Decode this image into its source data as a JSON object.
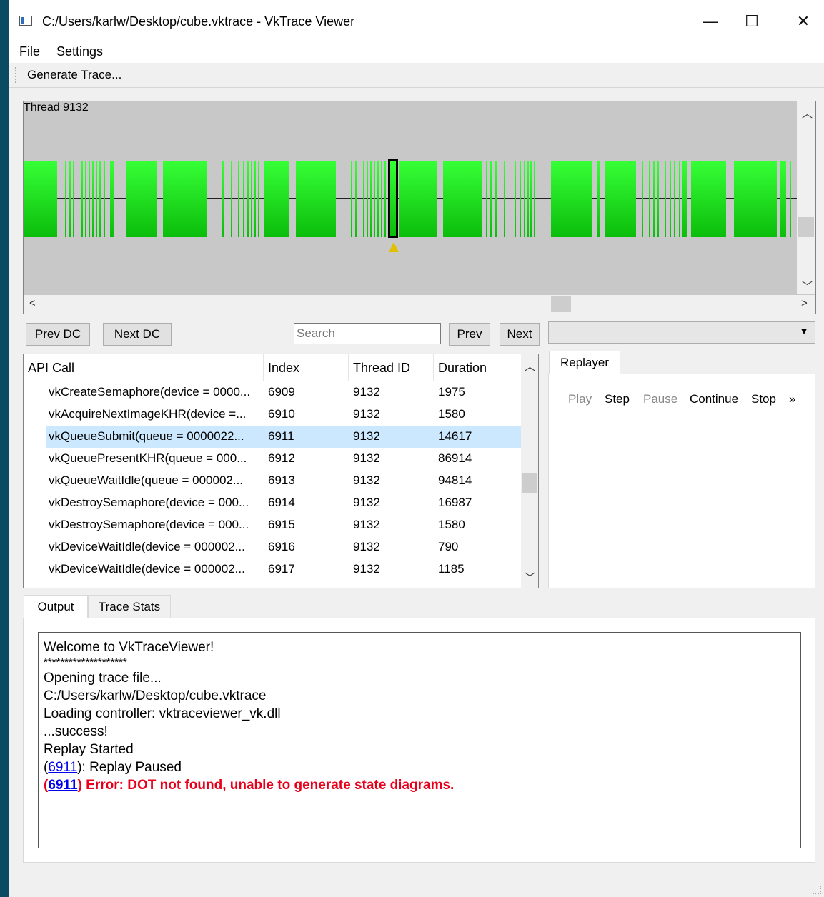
{
  "window": {
    "title": "C:/Users/karlw/Desktop/cube.vktrace - VkTrace Viewer",
    "minimize": "—",
    "maximize": "☐",
    "close": "✕"
  },
  "menu": {
    "file": "File",
    "settings": "Settings"
  },
  "toolbar": {
    "generate_trace": "Generate Trace..."
  },
  "timeline": {
    "thread_label": "Thread 9132"
  },
  "nav": {
    "prev_dc": "Prev DC",
    "next_dc": "Next DC",
    "search_placeholder": "Search",
    "prev": "Prev",
    "next": "Next",
    "combo_value": ""
  },
  "table": {
    "columns": [
      "API Call",
      "Index",
      "Thread ID",
      "Duration"
    ],
    "rows": [
      [
        "vkCreateSemaphore(device = 0000...",
        "6909",
        "9132",
        "1975"
      ],
      [
        "vkAcquireNextImageKHR(device =...",
        "6910",
        "9132",
        "1580"
      ],
      [
        "vkQueueSubmit(queue = 0000022...",
        "6911",
        "9132",
        "14617"
      ],
      [
        "vkQueuePresentKHR(queue = 000...",
        "6912",
        "9132",
        "86914"
      ],
      [
        "vkQueueWaitIdle(queue = 000002...",
        "6913",
        "9132",
        "94814"
      ],
      [
        "vkDestroySemaphore(device = 000...",
        "6914",
        "9132",
        "16987"
      ],
      [
        "vkDestroySemaphore(device = 000...",
        "6915",
        "9132",
        "1580"
      ],
      [
        "vkDeviceWaitIdle(device = 000002...",
        "6916",
        "9132",
        "790"
      ],
      [
        "vkDeviceWaitIdle(device = 000002...",
        "6917",
        "9132",
        "1185"
      ]
    ],
    "selected_index": 2
  },
  "replayer": {
    "tab": "Replayer",
    "play": "Play",
    "step": "Step",
    "pause": "Pause",
    "continue": "Continue",
    "stop": "Stop",
    "more": "»"
  },
  "bottom_tabs": {
    "output": "Output",
    "trace_stats": "Trace Stats"
  },
  "output": {
    "welcome": "Welcome to VkTraceViewer!",
    "stars": "********************",
    "opening": "Opening trace file...",
    "path": "C:/Users/karlw/Desktop/cube.vktrace",
    "loading": "Loading controller: vktraceviewer_vk.dll",
    "success": "...success!",
    "replay_started": "Replay Started",
    "paused_link": "6911",
    "paused_open": "(",
    "paused_text": "): Replay Paused",
    "error_link": "6911",
    "error_open": "(",
    "error_text": ") Error: DOT not found, unable to generate state diagrams."
  },
  "colors": {
    "bar_top": "#36ff36",
    "bar_bottom": "#0bbd0b",
    "selection": "#cce8ff",
    "error": "#e8001b",
    "link": "#0000ee",
    "desktop": "#0b4a63"
  }
}
